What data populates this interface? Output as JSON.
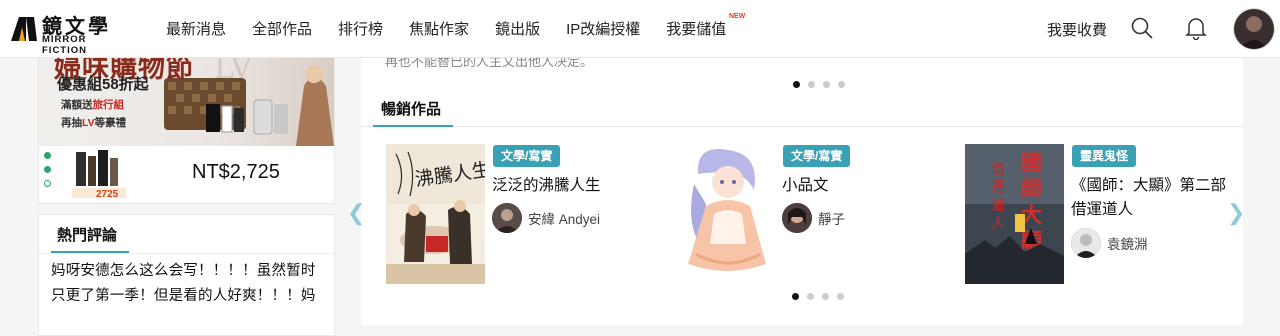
{
  "logo": {
    "cn": "鏡文學",
    "en": "MIRROR FICTION"
  },
  "nav": {
    "items": [
      "最新消息",
      "全部作品",
      "排行榜",
      "焦點作家",
      "鏡出版",
      "IP改編授權",
      "我要儲值"
    ],
    "new_badge": "NEW"
  },
  "header_right": {
    "pay_label": "我要收費"
  },
  "ad": {
    "title": "婦味購物節",
    "subtitle": "優惠組58折起",
    "line1_prefix": "滿額送",
    "line1_highlight": "旅行組",
    "line2_prefix": "再抽",
    "line2_highlight": "LV",
    "line2_suffix": "等豪禮",
    "thumb_price": "2725",
    "price": "NT$2,725"
  },
  "hot_comments": {
    "title": "熱門評論",
    "text": "妈呀安德怎么这么会写！！！！虽然暂时只更了第一季！但是看的人好爽！！！妈"
  },
  "prev_text": "再也不能替已的人主文出他人决定。",
  "bestsellers": {
    "title": "暢銷作品",
    "books": [
      {
        "tag": "文學/寫實",
        "title": "泛泛的沸騰人生",
        "author": "安緯 Andyei"
      },
      {
        "tag": "文學/寫實",
        "title": "小品文",
        "author": "靜子"
      },
      {
        "tag": "靈異鬼怪",
        "title": "《國師：大顯》第二部 借運道人",
        "author": "袁鏡淵"
      }
    ]
  },
  "carousel": {
    "active_index": 0,
    "count": 4
  },
  "colors": {
    "accent": "#3aa1b4",
    "price_red": "#c62828",
    "nav_new": "#e53935",
    "dot_green": "#2ea36b"
  }
}
